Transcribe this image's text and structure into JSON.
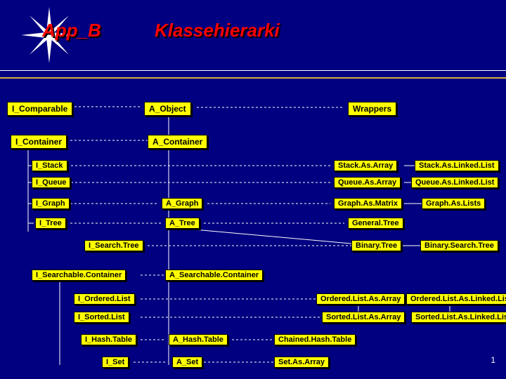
{
  "title": {
    "left": "App_B",
    "right": "Klassehierarki"
  },
  "boxes": {
    "i_comparable": "I_Comparable",
    "i_container": "I_Container",
    "a_object": "A_Object",
    "wrappers": "Wrappers",
    "a_container": "A_Container",
    "i_stack": "I_Stack",
    "i_queue": "I_Queue",
    "i_graph": "I_Graph",
    "i_tree": "I_Tree",
    "i_searchtree": "I_Search.Tree",
    "i_searchablecontainer": "I_Searchable.Container",
    "i_orderedlist": "I_Ordered.List",
    "i_sortedlist": "I_Sorted.List",
    "i_hashtable": "I_Hash.Table",
    "i_set": "I_Set",
    "a_graph": "A_Graph",
    "a_tree": "A_Tree",
    "a_searchablecontainer": "A_Searchable.Container",
    "a_hashtable": "A_Hash.Table",
    "a_set": "A_Set",
    "stack_array": "Stack.As.Array",
    "stack_linked": "Stack.As.Linked.List",
    "queue_array": "Queue.As.Array",
    "queue_linked": "Queue.As.Linked.List",
    "graph_matrix": "Graph.As.Matrix",
    "graph_lists": "Graph.As.Lists",
    "general_tree": "General.Tree",
    "binary_tree": "Binary.Tree",
    "binary_searchtree": "Binary.Search.Tree",
    "ordered_array": "Ordered.List.As.Array",
    "ordered_linked": "Ordered.List.As.Linked.List",
    "sorted_array": "Sorted.List.As.Array",
    "sorted_linked": "Sorted.List.As.Linked.List",
    "chained_hash": "Chained.Hash.Table",
    "set_array": "Set.As.Array"
  },
  "page_number": "1"
}
